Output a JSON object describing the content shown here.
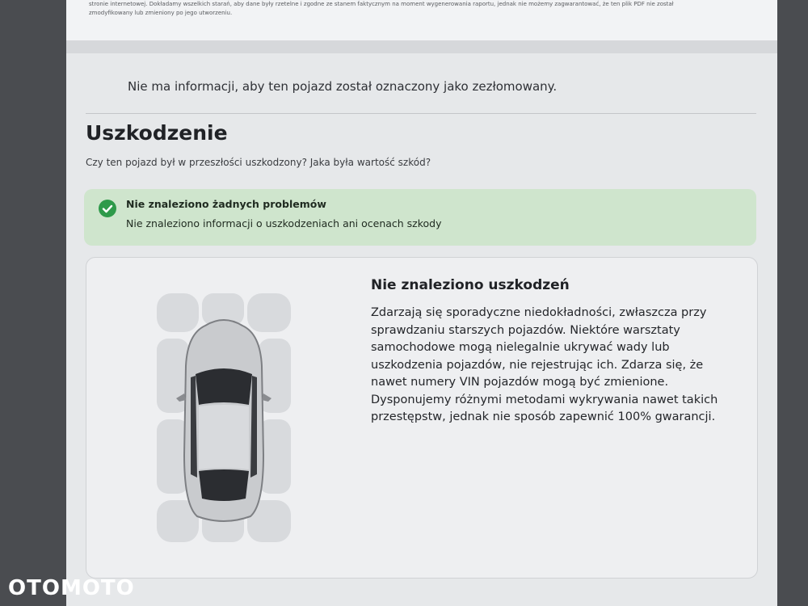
{
  "header_fine_print": {
    "line1": "stronie internetowej. Dokładamy wszelkich starań, aby dane były rzetelne i zgodne ze stanem faktycznym na moment wygenerowania raportu, jednak nie możemy zagwarantować, że ten plik PDF nie został",
    "line2": "zmodyfikowany lub zmieniony po jego utworzeniu."
  },
  "scrap_notice": "Nie ma informacji, aby ten pojazd został oznaczony jako zezłomowany.",
  "damage_section": {
    "title": "Uszkodzenie",
    "subtitle": "Czy ten pojazd był w przeszłości uszkodzony? Jaka była wartość szkód?",
    "alert": {
      "icon": "check-circle-icon",
      "title": "Nie znaleziono żadnych problemów",
      "text": "Nie znaleziono informacji o uszkodzeniach ani ocenach szkody",
      "color": "#cfe5cd"
    },
    "panel": {
      "title": "Nie znaleziono uszkodzeń",
      "body": "Zdarzają się sporadyczne niedokładności, zwłaszcza przy sprawdzaniu starszych pojazdów. Niektóre warsztaty samochodowe mogą nielegalnie ukrywać wady lub uszkodzenia pojazdów, nie rejestrując ich. Zdarza się, że nawet numery VIN pojazdów mogą być zmienione. Dysponujemy różnymi metodami wykrywania nawet takich przestępstw, jednak nie sposób zapewnić 100% gwarancji."
    }
  },
  "watermark": "OTOMOTO"
}
